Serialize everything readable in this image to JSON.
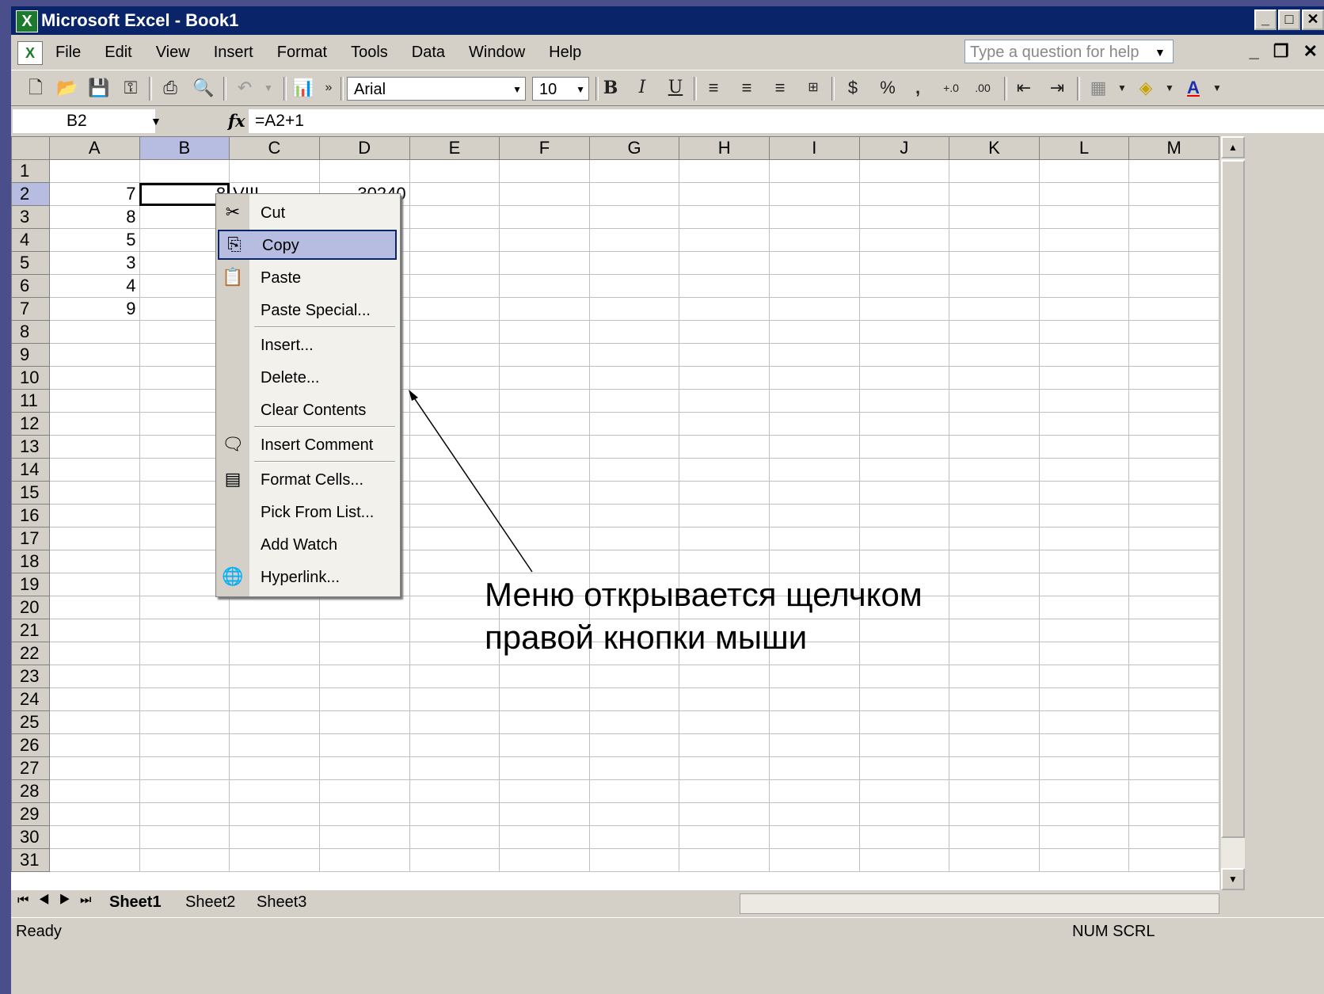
{
  "window": {
    "title": "Microsoft Excel - Book1"
  },
  "menu": {
    "items": [
      "File",
      "Edit",
      "View",
      "Insert",
      "Format",
      "Tools",
      "Data",
      "Window",
      "Help"
    ],
    "help_placeholder": "Type a question for help"
  },
  "toolbar": {
    "font": "Arial",
    "size": "10"
  },
  "formula_bar": {
    "cell": "B2",
    "fx": "fx",
    "formula": "=A2+1"
  },
  "grid": {
    "columns": [
      "A",
      "B",
      "C",
      "D",
      "E",
      "F",
      "G",
      "H",
      "I",
      "J",
      "K",
      "L",
      "M"
    ],
    "rows": [
      "1",
      "2",
      "3",
      "4",
      "5",
      "6",
      "7",
      "8",
      "9",
      "10",
      "11",
      "12",
      "13",
      "14",
      "15",
      "16",
      "17",
      "18",
      "19",
      "20",
      "21",
      "22",
      "23",
      "24",
      "25",
      "26",
      "27",
      "28",
      "29",
      "30",
      "31"
    ],
    "cells": {
      "A2": "7",
      "B2": "8",
      "C2": "VIII",
      "D2": "30240",
      "A3": "8",
      "A4": "5",
      "A5": "3",
      "A6": "4",
      "A7": "9"
    },
    "active_cell": "B2"
  },
  "context_menu": {
    "items": [
      "Cut",
      "Copy",
      "Paste",
      "Paste Special...",
      "Insert...",
      "Delete...",
      "Clear Contents",
      "Insert Comment",
      "Format Cells...",
      "Pick From List...",
      "Add Watch",
      "Hyperlink..."
    ],
    "highlighted": "Copy"
  },
  "sheets": [
    "Sheet1",
    "Sheet2",
    "Sheet3"
  ],
  "status": {
    "text": "Ready",
    "indicators": "NUM SCRL"
  },
  "annotation": {
    "line1": "Меню открывается щелчком",
    "line2": "правой кнопки мыши"
  }
}
